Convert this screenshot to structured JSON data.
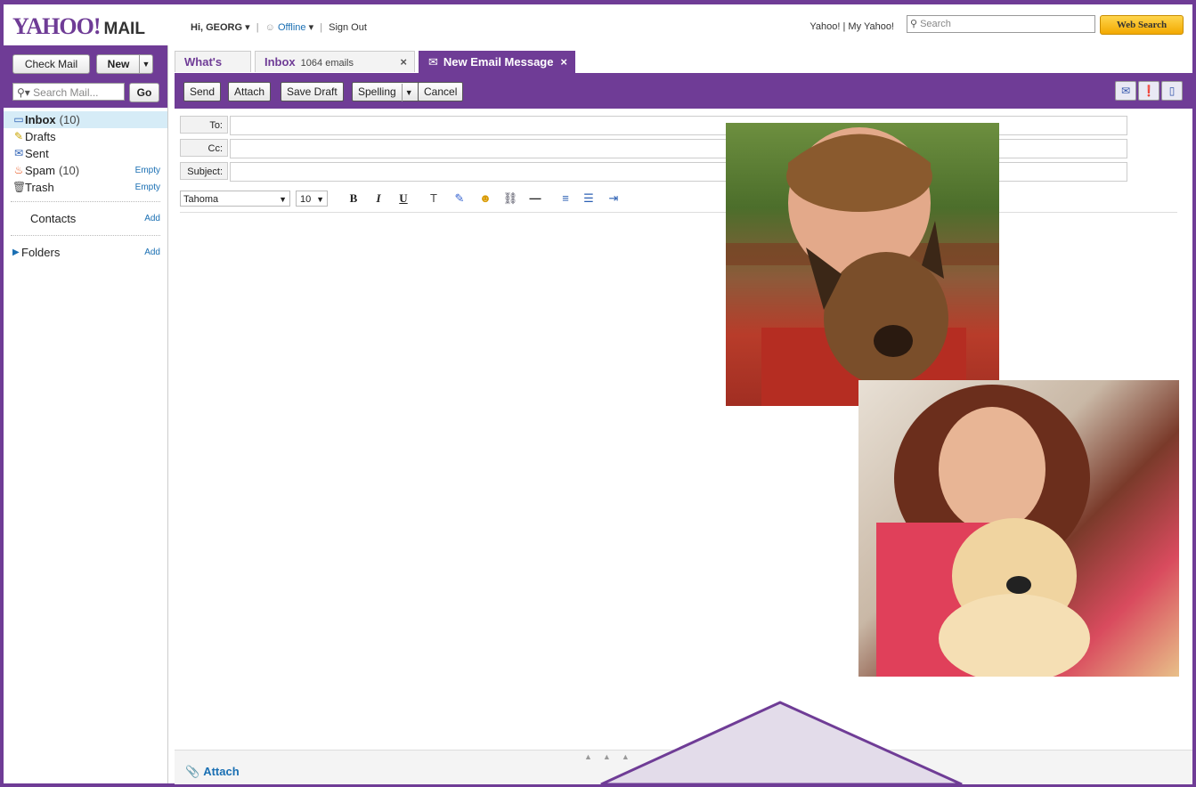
{
  "header": {
    "logo_text": "YAHOO!",
    "logo_mail": "MAIL",
    "greeting": "Hi, GEORG",
    "status": "Offline",
    "sign_out": "Sign Out",
    "links": "Yahoo! | My Yahoo!",
    "search_placeholder": "Search",
    "web_search_button": "Web Search"
  },
  "sidebar": {
    "check_mail": "Check Mail",
    "new_button": "New",
    "search_mail_placeholder": "Search Mail...",
    "go_button": "Go",
    "folders": [
      {
        "label": "Inbox",
        "count": "(10)",
        "action": "",
        "icon": "inbox-icon"
      },
      {
        "label": "Drafts",
        "count": "",
        "action": "",
        "icon": "drafts-icon"
      },
      {
        "label": "Sent",
        "count": "",
        "action": "",
        "icon": "sent-icon"
      },
      {
        "label": "Spam",
        "count": "(10)",
        "action": "Empty",
        "icon": "spam-icon"
      },
      {
        "label": "Trash",
        "count": "",
        "action": "Empty",
        "icon": "trash-icon"
      }
    ],
    "contacts_label": "Contacts",
    "contacts_add": "Add",
    "folders_label": "Folders",
    "folders_add": "Add"
  },
  "tabs": [
    {
      "label": "What's New",
      "sub": ""
    },
    {
      "label": "Inbox",
      "sub": "1064 emails"
    },
    {
      "label": "New Email Message",
      "sub": ""
    }
  ],
  "toolbar": {
    "send": "Send",
    "attach": "Attach",
    "save_draft": "Save Draft",
    "spelling": "Spelling",
    "cancel": "Cancel"
  },
  "compose": {
    "to_label": "To:",
    "cc_label": "Cc:",
    "subject_label": "Subject:",
    "font_family": "Tahoma",
    "font_size": "10",
    "bold": "B",
    "italic": "I",
    "underline": "U"
  },
  "footer": {
    "attach_link": "Attach"
  },
  "colors": {
    "brand": "#6f3c96",
    "link": "#1a6fb3"
  }
}
